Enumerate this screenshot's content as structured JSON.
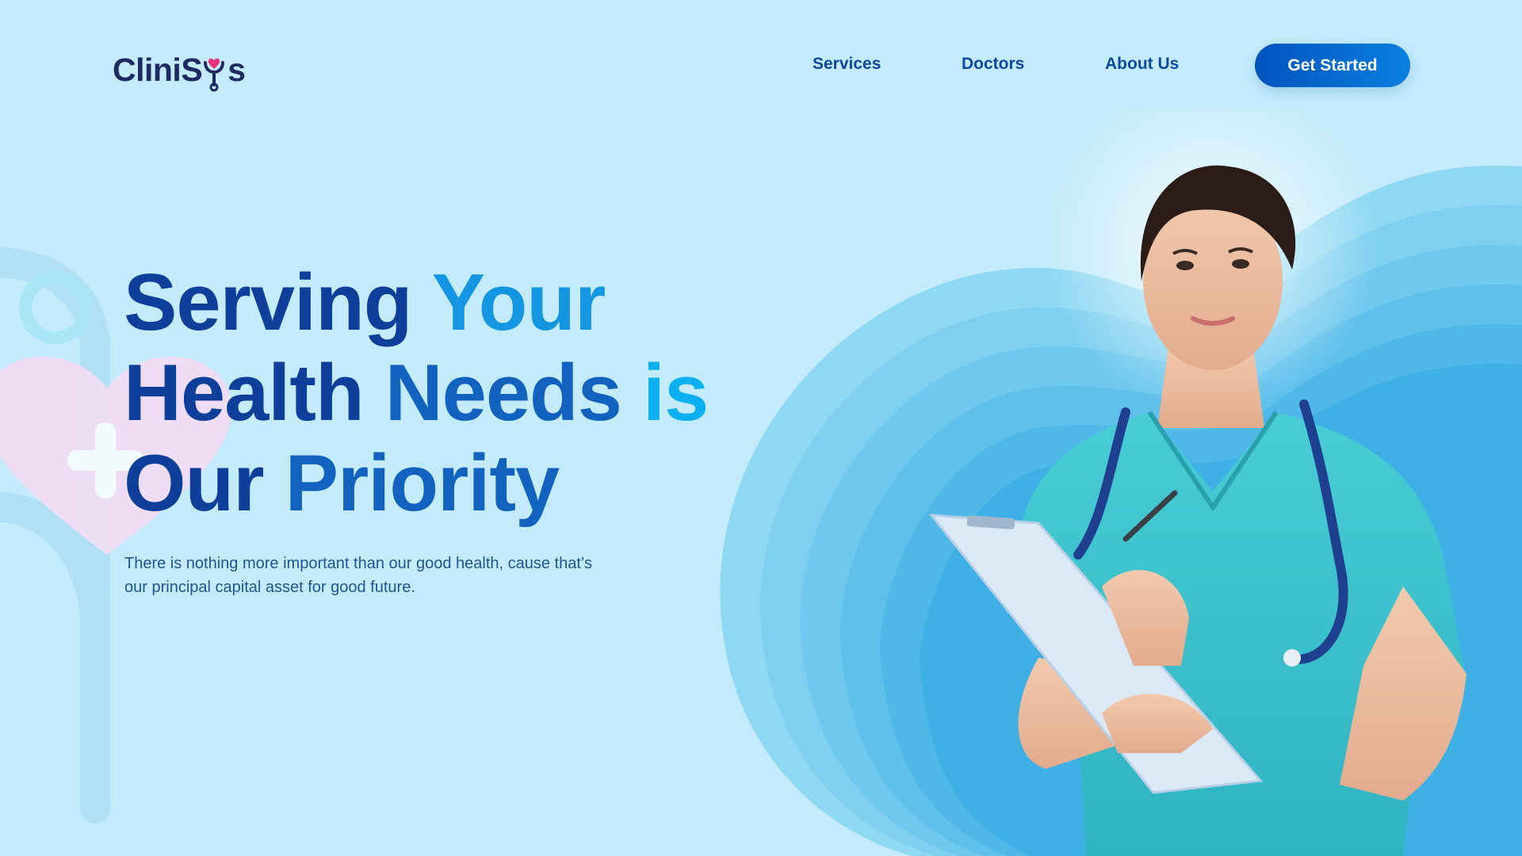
{
  "brand": {
    "name_prefix": "CliniS",
    "name_suffix": "s",
    "logo_icon": "stethoscope-heart-icon",
    "text_color": "#1f2a63",
    "heart_color": "#e8327a"
  },
  "nav": {
    "items": [
      {
        "label": "Services"
      },
      {
        "label": "Doctors"
      },
      {
        "label": "About Us"
      }
    ],
    "cta_label": "Get Started"
  },
  "hero": {
    "headline": {
      "line1": [
        "Serving",
        "Your"
      ],
      "line2": [
        "Health",
        "Needs",
        "is"
      ],
      "line3": [
        "Our",
        "Priority"
      ]
    },
    "subcopy_line1": "There is nothing more important than our good health, cause that’s",
    "subcopy_line2": "our principal capital asset for good future."
  },
  "colors": {
    "background": "#c4ebfb",
    "accent": "#0054bd",
    "heading_dark": "#0e3f9a",
    "heading_light": "#0ab0f2",
    "scrubs": "#3fc6cf"
  }
}
